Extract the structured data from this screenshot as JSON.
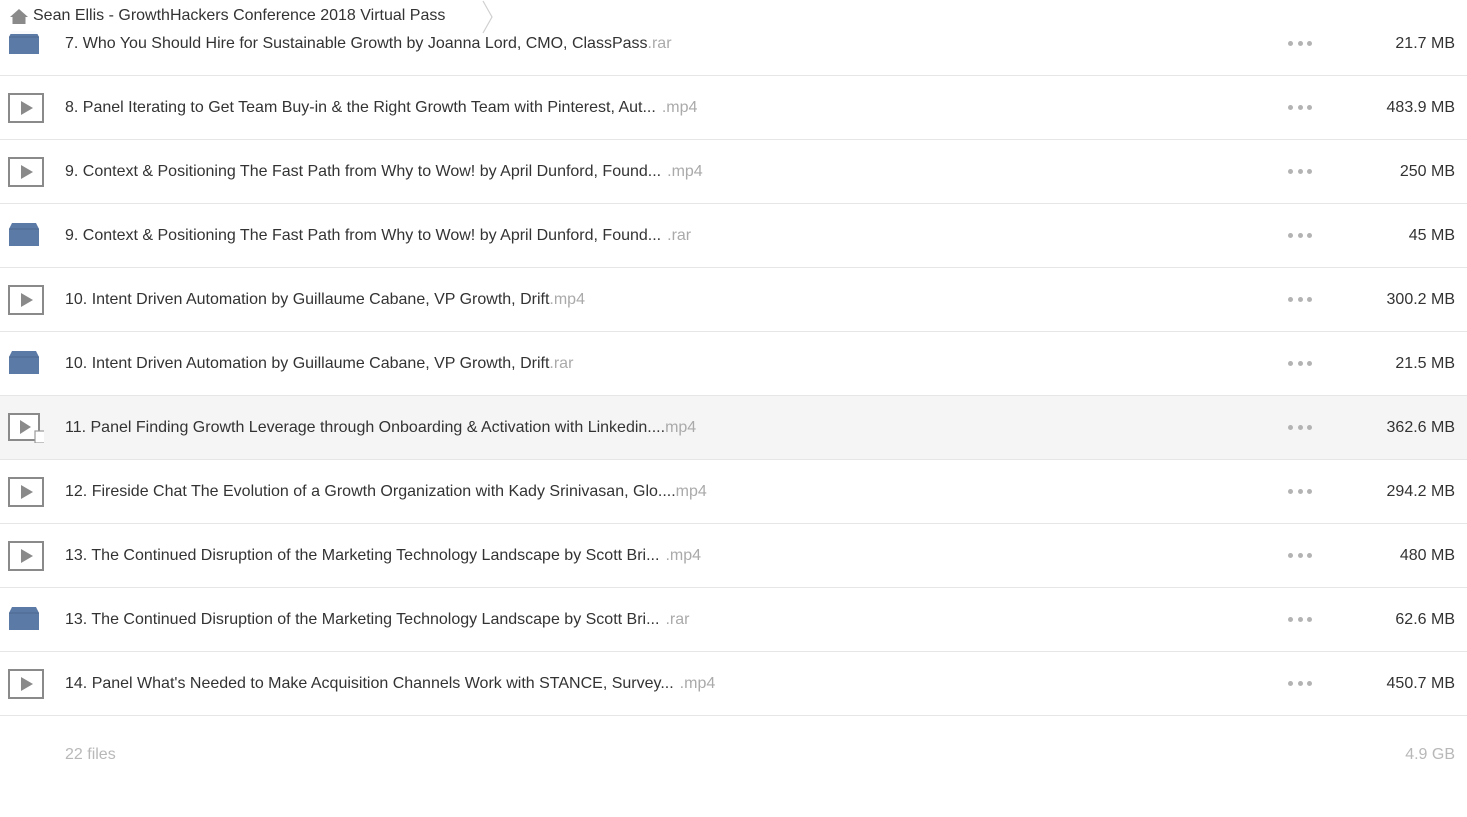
{
  "breadcrumb": {
    "home_icon": "home-icon",
    "current_folder": "Sean Ellis - GrowthHackers Conference 2018 Virtual Pass"
  },
  "files": [
    {
      "name": "7. Who You Should Hire for Sustainable Growth by Joanna Lord, CMO, ClassPass",
      "ext": ".rar",
      "size": "21.7 MB",
      "type": "archive"
    },
    {
      "name": "8. Panel Iterating to Get Team Buy-in & the Right Growth Team with Pinterest, Aut...",
      "ext": ".mp4",
      "size": "483.9 MB",
      "type": "video"
    },
    {
      "name": "9. Context & Positioning The Fast Path from Why to Wow! by April Dunford, Found...",
      "ext": ".mp4",
      "size": "250 MB",
      "type": "video"
    },
    {
      "name": "9. Context & Positioning The Fast Path from Why to Wow! by April Dunford, Found...",
      "ext": ".rar",
      "size": "45 MB",
      "type": "archive"
    },
    {
      "name": "10. Intent Driven Automation by Guillaume Cabane, VP Growth, Drift",
      "ext": ".mp4",
      "size": "300.2 MB",
      "type": "video"
    },
    {
      "name": "10. Intent Driven Automation by Guillaume Cabane, VP Growth, Drift",
      "ext": ".rar",
      "size": "21.5 MB",
      "type": "archive"
    },
    {
      "name": "11. Panel Finding Growth Leverage through Onboarding & Activation with Linkedin....",
      "ext": "mp4",
      "size": "362.6 MB",
      "type": "video-select"
    },
    {
      "name": "12. Fireside Chat The Evolution of a Growth Organization with Kady Srinivasan, Glo....",
      "ext": "mp4",
      "size": "294.2 MB",
      "type": "video"
    },
    {
      "name": "13. The Continued Disruption of the Marketing Technology Landscape by Scott Bri...",
      "ext": ".mp4",
      "size": "480 MB",
      "type": "video"
    },
    {
      "name": "13. The Continued Disruption of the Marketing Technology Landscape by Scott Bri...",
      "ext": ".rar",
      "size": "62.6 MB",
      "type": "archive"
    },
    {
      "name": "14. Panel What's Needed to Make Acquisition Channels Work with STANCE, Survey...",
      "ext": ".mp4",
      "size": "450.7 MB",
      "type": "video"
    }
  ],
  "summary": {
    "file_count": "22 files",
    "total_size": "4.9 GB"
  },
  "colors": {
    "archive_icon": "#5b7aa6",
    "video_icon": "#8a8a8a",
    "ext_text": "#aaaaaa",
    "divider": "#e6e6e6"
  }
}
